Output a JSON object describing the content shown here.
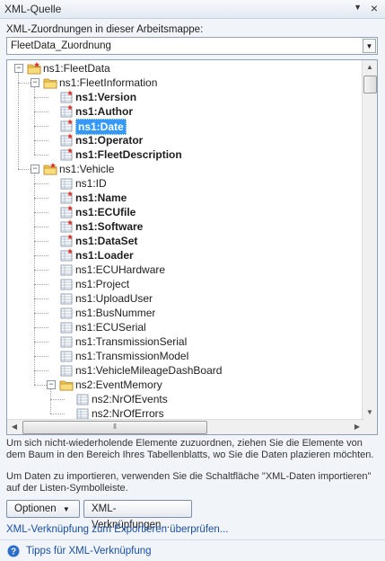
{
  "window": {
    "title": "XML-Quelle"
  },
  "maps": {
    "label": "XML-Zuordnungen in dieser Arbeitsmappe:",
    "selected": "FleetData_Zuordnung"
  },
  "tree": [
    {
      "label": "ns1:FleetData",
      "level": 0,
      "type": "root",
      "expanded": true,
      "bold": false
    },
    {
      "label": "ns1:FleetInformation",
      "level": 1,
      "type": "folder",
      "expanded": true,
      "bold": false
    },
    {
      "label": "ns1:Version",
      "level": 2,
      "type": "required",
      "bold": true
    },
    {
      "label": "ns1:Author",
      "level": 2,
      "type": "required",
      "bold": true
    },
    {
      "label": "ns1:Date",
      "level": 2,
      "type": "required",
      "bold": true,
      "selected": true
    },
    {
      "label": "ns1:Operator",
      "level": 2,
      "type": "required",
      "bold": true
    },
    {
      "label": "ns1:FleetDescription",
      "level": 2,
      "type": "required",
      "bold": true
    },
    {
      "label": "ns1:Vehicle",
      "level": 1,
      "type": "root",
      "expanded": true,
      "bold": false
    },
    {
      "label": "ns1:ID",
      "level": 2,
      "type": "element",
      "bold": false
    },
    {
      "label": "ns1:Name",
      "level": 2,
      "type": "required",
      "bold": true
    },
    {
      "label": "ns1:ECUfile",
      "level": 2,
      "type": "required",
      "bold": true
    },
    {
      "label": "ns1:Software",
      "level": 2,
      "type": "required",
      "bold": true
    },
    {
      "label": "ns1:DataSet",
      "level": 2,
      "type": "required",
      "bold": true
    },
    {
      "label": "ns1:Loader",
      "level": 2,
      "type": "required",
      "bold": true
    },
    {
      "label": "ns1:ECUHardware",
      "level": 2,
      "type": "element",
      "bold": false
    },
    {
      "label": "ns1:Project",
      "level": 2,
      "type": "element",
      "bold": false
    },
    {
      "label": "ns1:UploadUser",
      "level": 2,
      "type": "element",
      "bold": false
    },
    {
      "label": "ns1:BusNummer",
      "level": 2,
      "type": "element",
      "bold": false
    },
    {
      "label": "ns1:ECUSerial",
      "level": 2,
      "type": "element",
      "bold": false
    },
    {
      "label": "ns1:TransmissionSerial",
      "level": 2,
      "type": "element",
      "bold": false
    },
    {
      "label": "ns1:TransmissionModel",
      "level": 2,
      "type": "element",
      "bold": false
    },
    {
      "label": "ns1:VehicleMileageDashBoard",
      "level": 2,
      "type": "element",
      "bold": false
    },
    {
      "label": "ns2:EventMemory",
      "level": 2,
      "type": "folder",
      "expanded": true,
      "bold": false
    },
    {
      "label": "ns2:NrOfEvents",
      "level": 3,
      "type": "element",
      "bold": false
    },
    {
      "label": "ns2:NrOfErrors",
      "level": 3,
      "type": "element",
      "bold": false
    }
  ],
  "hints": {
    "drag": "Um sich nicht-wiederholende Elemente zuzuordnen, ziehen Sie die Elemente von dem Baum in den Bereich Ihres Tabellenblatts, wo Sie die Daten plazieren möchten.",
    "import": "Um Daten zu importieren, verwenden Sie die Schaltfläche \"XML-Daten importieren\" auf der Listen-Symbolleiste."
  },
  "buttons": {
    "options": "Optionen",
    "mappings": "XML-Verknüpfungen..."
  },
  "links": {
    "verify": "XML-Verknüpfung zum Exportieren überprüfen...",
    "tips": "Tipps für XML-Verknüpfung"
  },
  "colors": {
    "accent": "#3399ff",
    "link": "#1a4fa3"
  }
}
